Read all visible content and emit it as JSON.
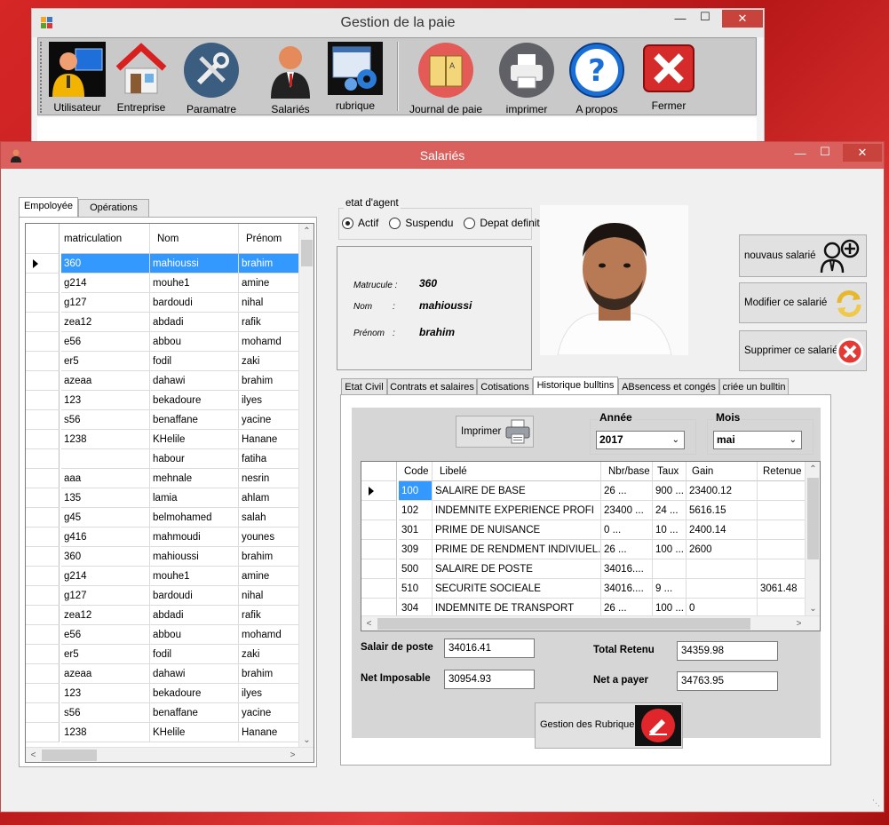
{
  "main_window": {
    "title": "Gestion de la paie",
    "toolbar": [
      {
        "label": "Utilisateur",
        "icon": "user-computer-icon"
      },
      {
        "label": "Entreprise",
        "icon": "house-icon"
      },
      {
        "label": "Paramatre",
        "icon": "tools-icon"
      },
      {
        "label": "Salariés",
        "icon": "employee-icon"
      },
      {
        "label": "rubrique",
        "icon": "settings-window-icon"
      },
      {
        "label": "Journal de paie",
        "icon": "journal-book-icon"
      },
      {
        "label": "imprimer",
        "icon": "printer-icon"
      },
      {
        "label": "A propos",
        "icon": "help-icon"
      },
      {
        "label": "Fermer",
        "icon": "close-x-icon"
      }
    ]
  },
  "salaries_window": {
    "title": "Salariés",
    "left_tabs": [
      "Empoloyée",
      "Opérations"
    ],
    "employee_grid": {
      "headers": [
        "matriculation",
        "Nom",
        "Prénom"
      ],
      "selected_row": 0,
      "rows": [
        [
          "360",
          "mahioussi",
          "brahim"
        ],
        [
          "g214",
          "mouhe1",
          "amine"
        ],
        [
          "g127",
          "bardoudi",
          "nihal"
        ],
        [
          "zea12",
          "abdadi",
          "rafik"
        ],
        [
          "e56",
          "abbou",
          "mohamd"
        ],
        [
          "er5",
          "fodil",
          "zaki"
        ],
        [
          "azeaa",
          "dahawi",
          "brahim"
        ],
        [
          "123",
          "bekadoure",
          "ilyes"
        ],
        [
          "s56",
          "benaffane",
          "yacine"
        ],
        [
          "1238",
          "KHelile",
          "Hanane"
        ],
        [
          "",
          "habour",
          "fatiha"
        ],
        [
          "aaa",
          "mehnale",
          "nesrin"
        ],
        [
          "135",
          "lamia",
          "ahlam"
        ],
        [
          "g45",
          "belmohamed",
          "salah"
        ],
        [
          "g416",
          "mahmoudi",
          "younes"
        ],
        [
          "360",
          "mahioussi",
          "brahim"
        ],
        [
          "g214",
          "mouhe1",
          "amine"
        ],
        [
          "g127",
          "bardoudi",
          "nihal"
        ],
        [
          "zea12",
          "abdadi",
          "rafik"
        ],
        [
          "e56",
          "abbou",
          "mohamd"
        ],
        [
          "er5",
          "fodil",
          "zaki"
        ],
        [
          "azeaa",
          "dahawi",
          "brahim"
        ],
        [
          "123",
          "bekadoure",
          "ilyes"
        ],
        [
          "s56",
          "benaffane",
          "yacine"
        ],
        [
          "1238",
          "KHelile",
          "Hanane"
        ]
      ]
    },
    "etat": {
      "legend": "etat d'agent",
      "options": [
        "Actif",
        "Suspendu",
        "Depat definitif"
      ],
      "selected": "Actif"
    },
    "info": {
      "matricule_label": "Matrucule :",
      "matricule_value": "360",
      "nom_label": "Nom",
      "nom_colon": ":",
      "nom_value": "mahioussi",
      "prenom_label": "Prénom",
      "prenom_colon": ":",
      "prenom_value": "brahim"
    },
    "actions": {
      "new": "nouvaus salarié",
      "modify": "Modifier ce salarié",
      "delete": "Supprimer ce  salarié"
    },
    "detail_tabs": [
      "Etat Civil",
      "Contrats et salaires",
      "Cotisations",
      "Historique bulltins",
      "ABsencess et congés",
      "criée un bulltin"
    ],
    "bulletin": {
      "print_label": "Imprimer",
      "annee_label": "Année",
      "annee_value": "2017",
      "mois_label": "Mois",
      "mois_value": "mai",
      "grid_headers": [
        "Code",
        "Libelé",
        "Nbr/base",
        "Taux",
        "Gain",
        "Retenue"
      ],
      "selected_row": 0,
      "grid_rows": [
        [
          "100",
          "SALAIRE DE BASE",
          "26        ...",
          "900 ...",
          "23400.12",
          ""
        ],
        [
          "102",
          "INDEMNITE EXPERIENCE PROFI",
          "23400   ...",
          "24   ...",
          "5616.15",
          ""
        ],
        [
          "301",
          "PRIME DE NUISANCE",
          "0          ...",
          "10   ...",
          "2400.14",
          ""
        ],
        [
          "309",
          "PRIME DE RENDMENT INDIVIUEL...",
          "26        ...",
          "100 ...",
          "2600",
          ""
        ],
        [
          "500",
          "SALAIRE DE POSTE",
          "34016....",
          "",
          "",
          ""
        ],
        [
          "510",
          "SECURITE SOCIEALE",
          "34016....",
          "9     ...",
          "",
          "3061.48"
        ],
        [
          "304",
          "INDEMNITE DE TRANSPORT",
          "26        ...",
          "100 ...",
          "0",
          ""
        ]
      ],
      "salaire_poste_label": "Salair de poste",
      "salaire_poste_value": "34016.41",
      "net_imposable_label": "Net  Imposable",
      "net_imposable_value": "30954.93",
      "total_retenu_label": "Total Retenu",
      "total_retenu_value": "34359.98",
      "net_payer_label": "Net a payer",
      "net_payer_value": "34763.95",
      "rubrique_button": "Gestion des Rubrique"
    }
  }
}
